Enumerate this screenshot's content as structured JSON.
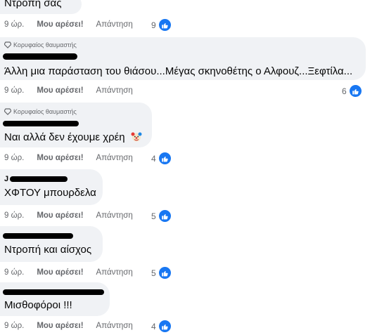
{
  "badge_label": "Κορυφαίος θαυμαστής",
  "actions": {
    "like": "Μου αρέσει!",
    "reply": "Απάντηση"
  },
  "colors": {
    "bubble": "#f0f2f5",
    "like_blue": "#1877f2",
    "meta_gray": "#65676b",
    "text": "#050505"
  },
  "comments": [
    {
      "text": "Ντροπή σας",
      "time": "9 ώρ.",
      "reactions": "9",
      "reaction_icon": "like-icon"
    },
    {
      "badge": true,
      "text": "Άλλη μια παράσταση του θιάσου...Μέγας σκηνοθέτης ο Αλφουζ...Ξεφτίλα...",
      "time": "9 ώρ.",
      "reactions": "6",
      "reaction_icon": "like-icon",
      "author_redacted": true
    },
    {
      "badge": true,
      "text": "Ναι αλλά δεν έχουμε χρέη",
      "emoji": "clown-face-icon",
      "time": "9 ώρ.",
      "reactions": "4",
      "reaction_icon": "like-icon",
      "author_redacted": true
    },
    {
      "author_fragment": "J",
      "text": "ΧΦΤΟΥ μπουρδελα",
      "time": "9 ώρ.",
      "reactions": "5",
      "reaction_icon": "like-icon",
      "author_redacted": true
    },
    {
      "text": "Ντροπή και αίσχος",
      "time": "9 ώρ.",
      "reactions": "5",
      "reaction_icon": "like-icon",
      "author_redacted": true
    },
    {
      "text": "Μισθοφόροι !!!",
      "time": "9 ώρ.",
      "reactions": "4",
      "reaction_icon": "like-icon",
      "author_redacted": true
    }
  ]
}
